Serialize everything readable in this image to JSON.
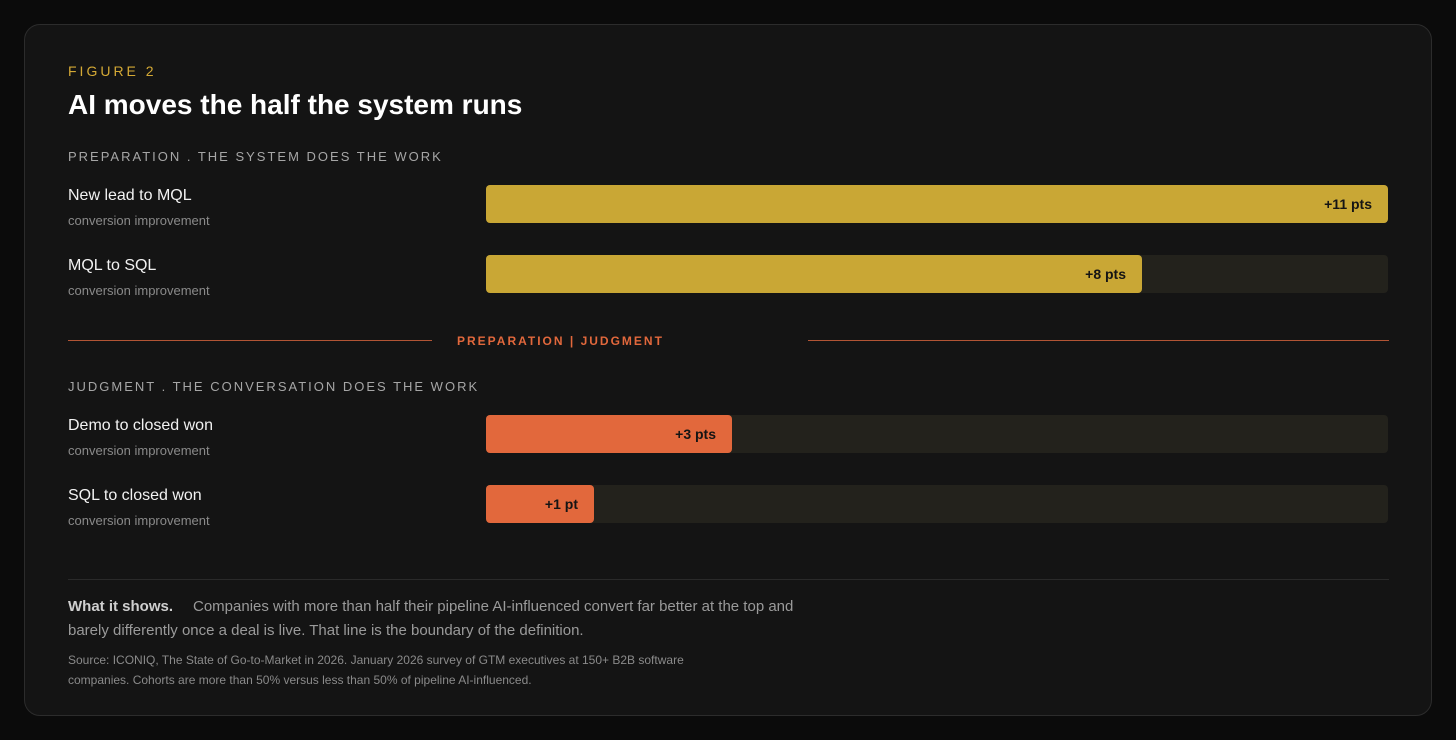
{
  "figure": {
    "eyebrow": "FIGURE 2",
    "title": "AI moves the half the system runs"
  },
  "sections": {
    "preparation": "PREPARATION . THE SYSTEM DOES THE WORK",
    "judgment": "JUDGMENT . THE CONVERSATION DOES THE WORK",
    "divider": "PREPARATION | JUDGMENT"
  },
  "colors": {
    "preparation": "#c9a735",
    "judgment": "#e2683c"
  },
  "chart_data": {
    "type": "bar",
    "orientation": "horizontal",
    "xlim": [
      0,
      11
    ],
    "categories": [
      "New lead to MQL",
      "MQL to SQL",
      "Demo to closed won",
      "SQL to closed won"
    ],
    "subtitles": [
      "conversion improvement",
      "conversion improvement",
      "conversion improvement",
      "conversion improvement"
    ],
    "values": [
      11,
      8,
      3,
      1
    ],
    "value_labels": [
      "+11 pts",
      "+8 pts",
      "+3 pts",
      "+1 pt"
    ],
    "groups": [
      "preparation",
      "preparation",
      "judgment",
      "judgment"
    ]
  },
  "footer": {
    "shows_lead": "What it shows.",
    "shows_text": "Companies with more than half their pipeline AI-influenced convert far better at the top and barely differently once a deal is live. That line is the boundary of the definition.",
    "source": "Source: ICONIQ, The State of Go-to-Market in 2026. January 2026 survey of GTM executives at 150+ B2B software companies. Cohorts are more than 50% versus less than 50% of pipeline AI-influenced."
  }
}
